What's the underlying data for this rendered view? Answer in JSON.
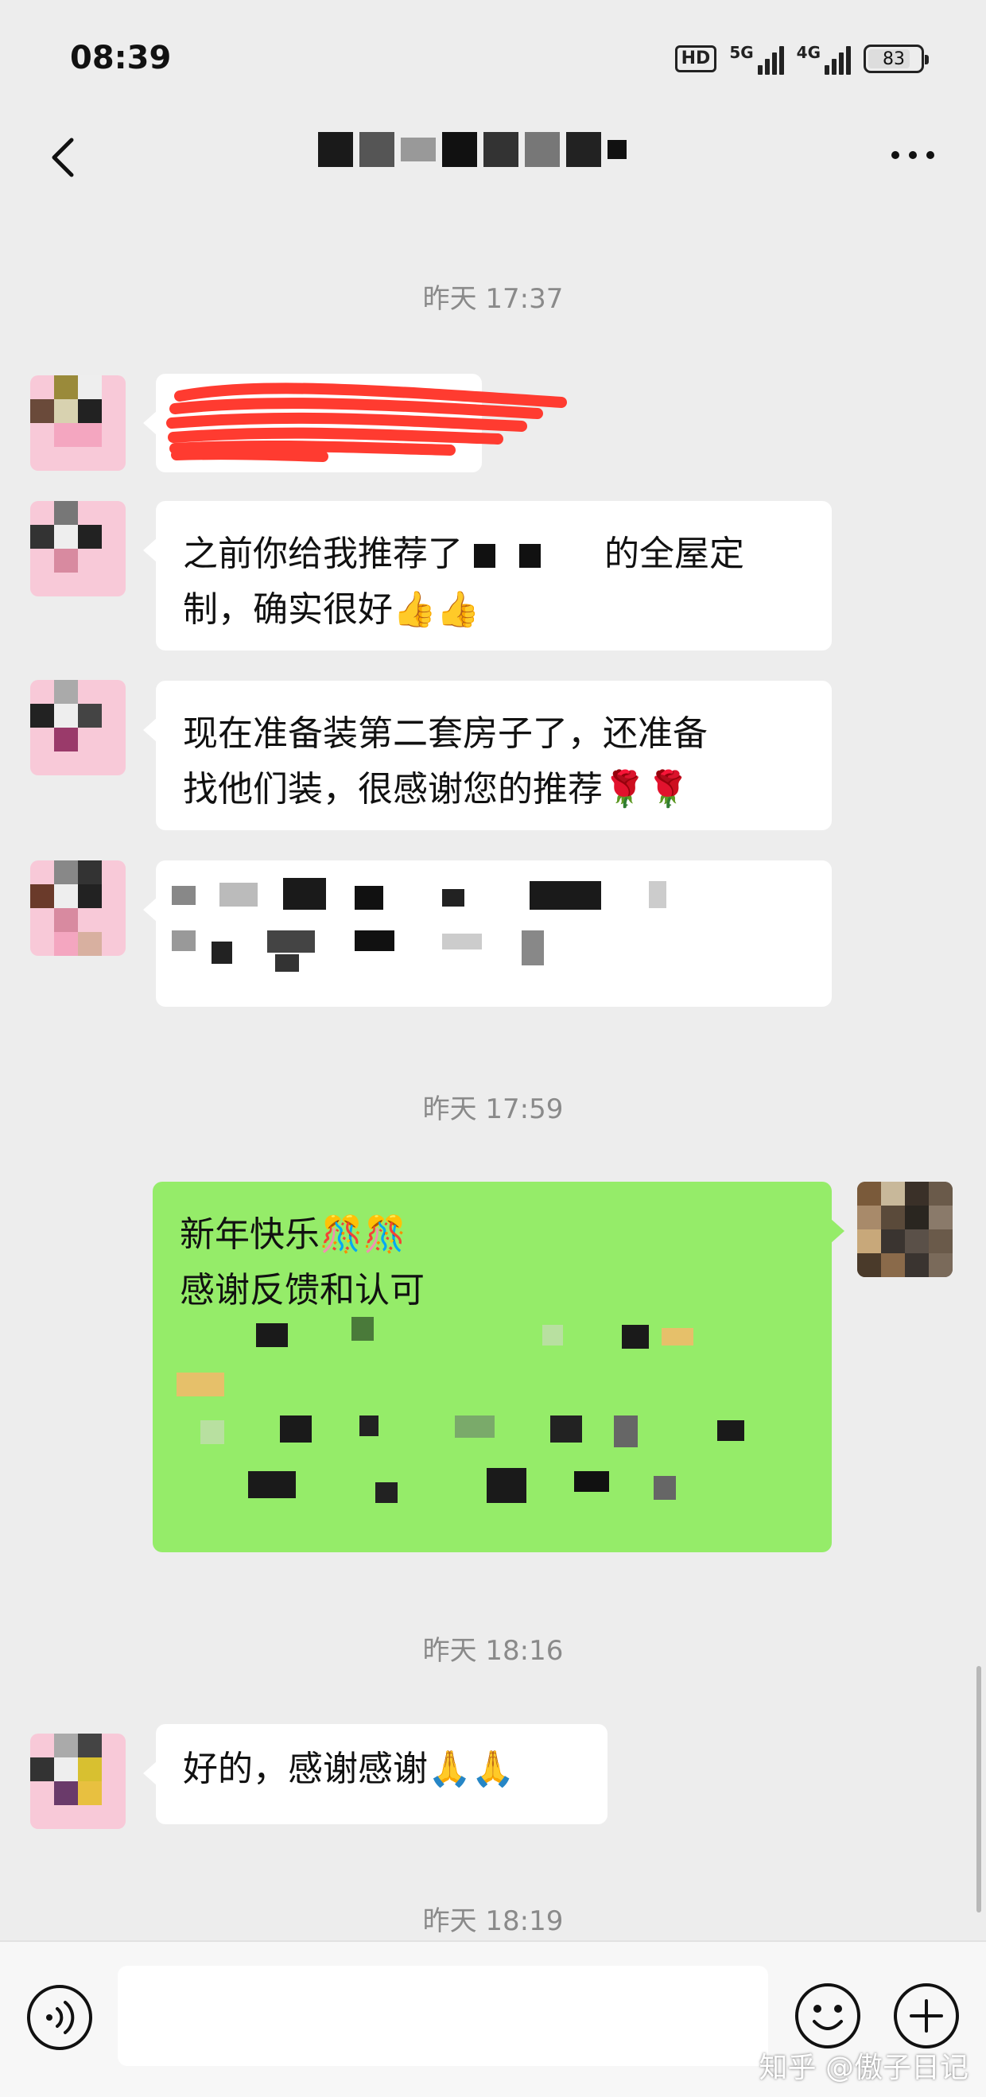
{
  "status_bar": {
    "time": "08:39",
    "hd_label": "HD",
    "net1_label": "5G",
    "net2_label": "4G",
    "battery_level": 83,
    "battery_text": "83"
  },
  "nav": {
    "back_icon": "chevron-left-icon",
    "title_redacted": true,
    "more_icon": "more-dots-icon"
  },
  "messages": {
    "ts1": "昨天 17:37",
    "msg2_line1": "之前你给我推荐了",
    "msg2_line1_end": "的全屋定",
    "msg2_line2": "制，确实很好👍👍",
    "msg3_line1": "现在准备装第二套房子了，还准备",
    "msg3_line2": "找他们装，很感谢您的推荐🌹🌹",
    "ts2": "昨天 17:59",
    "msg5_line1": "新年快乐🎊🎊",
    "msg5_line2": "感谢反馈和认可",
    "ts3": "昨天 18:16",
    "msg6_text": "好的，感谢感谢🙏🙏",
    "ts4": "昨天 18:19"
  },
  "input_bar": {
    "voice_icon": "voice-icon",
    "emoji_icon": "smiley-icon",
    "plus_icon": "plus-icon",
    "input_value": ""
  },
  "watermark": "知乎 @傲子日记",
  "colors": {
    "background": "#ededed",
    "bubble_in": "#ffffff",
    "bubble_out": "#95ec69",
    "redaction": "#ff3b30",
    "timestamp": "#8a8a8a"
  }
}
